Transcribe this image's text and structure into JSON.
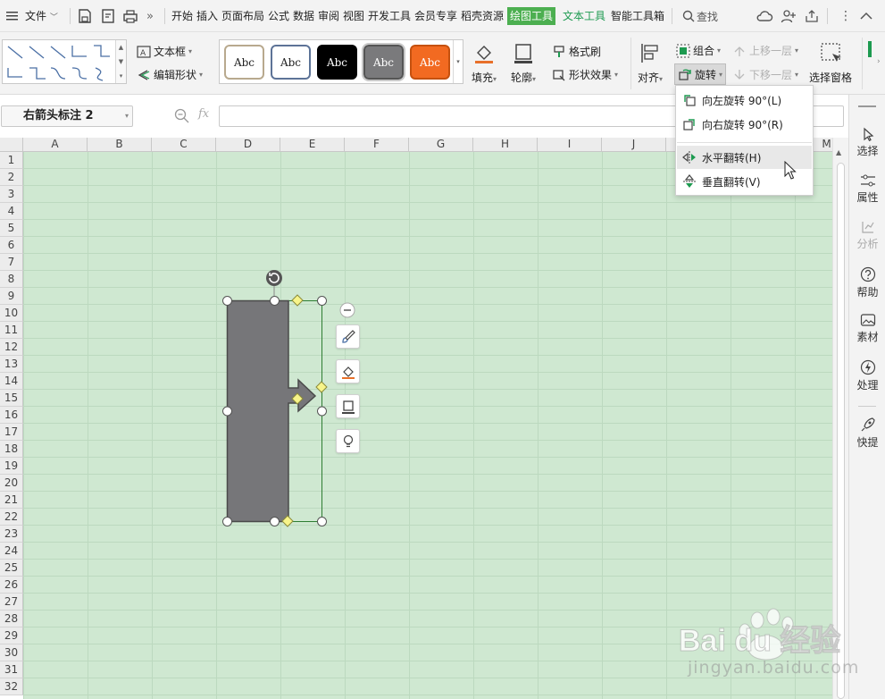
{
  "menu": {
    "file_label": "文件",
    "tabs": [
      "开始",
      "插入",
      "页面布局",
      "公式",
      "数据",
      "审阅",
      "视图",
      "开发工具",
      "会员专享",
      "稻壳资源",
      "绘图工具",
      "文本工具",
      "智能工具箱"
    ],
    "search_label": "查找"
  },
  "ribbon": {
    "text_box_label": "文本框",
    "edit_shape_label": "编辑形状",
    "style_presets": [
      "Abc",
      "Abc",
      "Abc",
      "Abc",
      "Abc"
    ],
    "fill_label": "填充",
    "outline_label": "轮廓",
    "format_painter_label": "格式刷",
    "shape_effect_label": "形状效果",
    "align_label": "对齐",
    "group_label": "组合",
    "rotate_label": "旋转",
    "bring_forward_label": "上移一层",
    "send_backward_label": "下移一层",
    "selection_pane_label": "选择窗格"
  },
  "formula_bar": {
    "name_box": "右箭头标注 2",
    "fx_label": "fx",
    "value": ""
  },
  "sheet": {
    "columns": [
      "A",
      "B",
      "C",
      "D",
      "E",
      "F",
      "G",
      "H",
      "I",
      "J",
      "K",
      "L",
      "M"
    ],
    "rows": [
      "1",
      "2",
      "3",
      "4",
      "5",
      "6",
      "7",
      "8",
      "9",
      "10",
      "11",
      "12",
      "13",
      "14",
      "15",
      "16",
      "17",
      "18",
      "19",
      "20",
      "21",
      "22",
      "23",
      "24",
      "25",
      "26",
      "27",
      "28",
      "29",
      "30",
      "31",
      "32"
    ]
  },
  "rotate_menu": {
    "items": [
      {
        "label": "向左旋转 90°(L)"
      },
      {
        "label": "向右旋转 90°(R)"
      },
      {
        "label": "水平翻转(H)"
      },
      {
        "label": "垂直翻转(V)"
      }
    ]
  },
  "side_panel": {
    "items": [
      {
        "label": "选择",
        "icon": "cursor-icon"
      },
      {
        "label": "属性",
        "icon": "sliders-icon"
      },
      {
        "label": "分析",
        "icon": "analysis-icon"
      },
      {
        "label": "帮助",
        "icon": "help-icon"
      },
      {
        "label": "素材",
        "icon": "material-icon"
      },
      {
        "label": "处理",
        "icon": "process-icon"
      },
      {
        "label": "快提",
        "icon": "rocket-icon"
      }
    ]
  },
  "watermark": {
    "brand": "Bai du 经验",
    "url": "jingyan.baidu.com"
  },
  "colors": {
    "active_tab_bg": "#4caf50",
    "text_tool_green": "#1d9a50",
    "sheet_bg": "#cfe8d1",
    "shape_fill": "#767679",
    "orange_style": "#f26a21"
  }
}
